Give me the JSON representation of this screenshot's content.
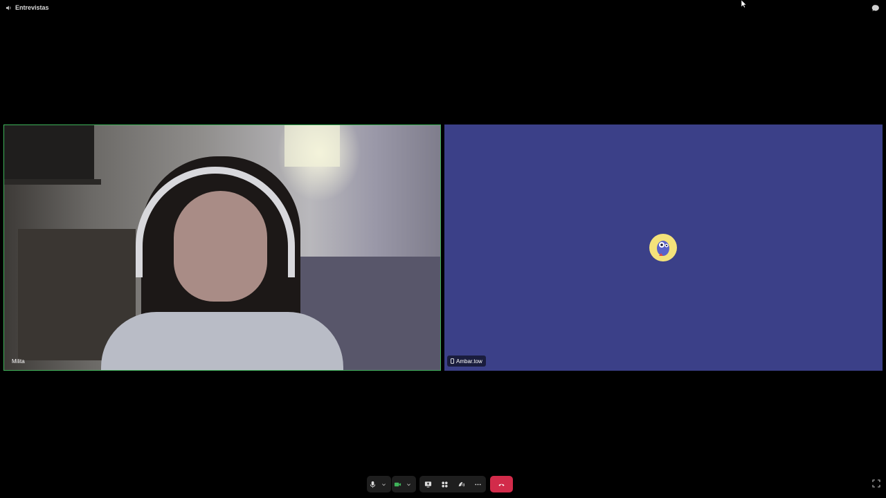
{
  "channel": {
    "name": "Entrevistas",
    "icon": "speaker-icon"
  },
  "tiles": [
    {
      "participant": "Milita",
      "type": "webcam",
      "speaking": true,
      "border_color": "#3fb45a"
    },
    {
      "participant": "Ambar.tow",
      "type": "avatar",
      "device_icon": "mobile-phone-icon",
      "background": "#3b4088"
    }
  ],
  "controls": {
    "mic": "microphone-icon",
    "camera": "video-camera-icon",
    "share": "screen-share-icon",
    "activities": "grid-apps-icon",
    "soundboard": "soundboard-icon",
    "more": "more-dots-icon",
    "end_call": "phone-hangup-icon",
    "end_call_color": "#d22b4a",
    "camera_active_color": "#3fb45a"
  }
}
